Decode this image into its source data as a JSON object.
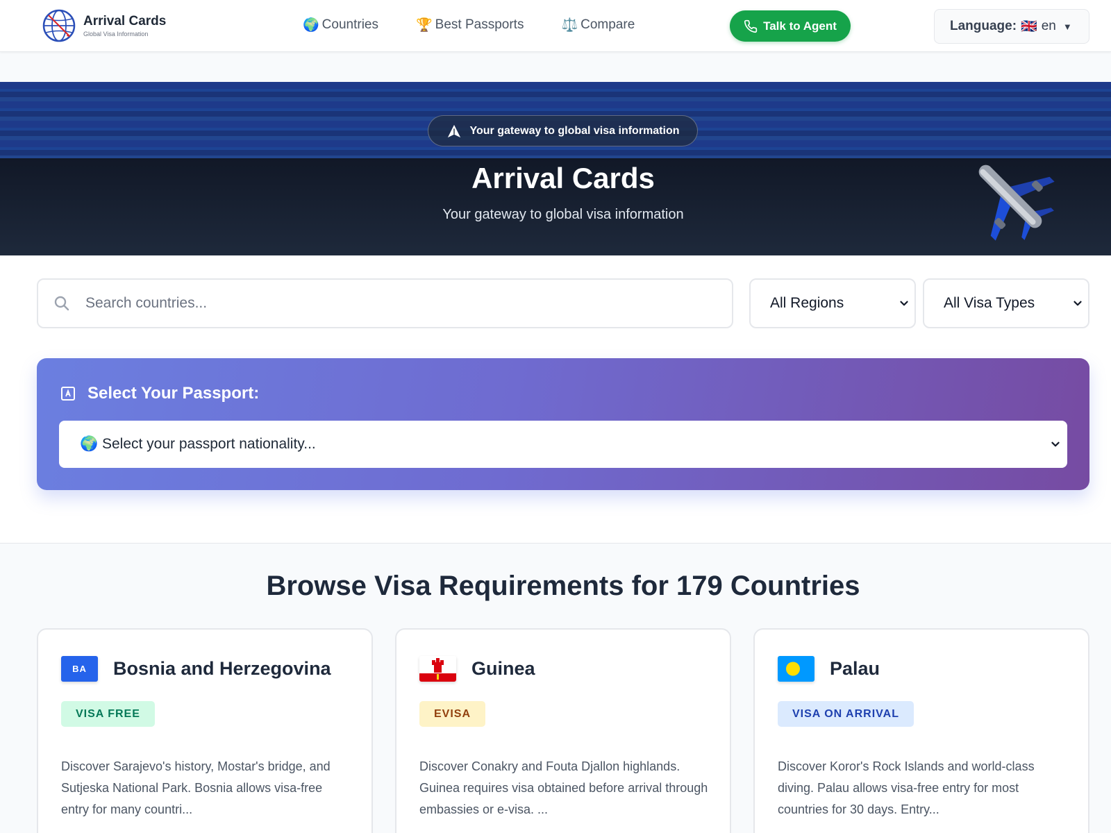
{
  "brand": {
    "title": "Arrival Cards",
    "subtitle": "Global Visa Information"
  },
  "nav": [
    {
      "icon": "🌍",
      "label": "Countries"
    },
    {
      "icon": "🏆",
      "label": "Best Passports"
    },
    {
      "icon": "⚖️",
      "label": "Compare"
    }
  ],
  "header": {
    "agent_button": "Talk to Agent",
    "language_label": "Language:",
    "language_flag": "🇬🇧",
    "language_code": "en",
    "language_caret": "▼"
  },
  "hero": {
    "badge": "Your gateway to global visa information",
    "title": "Arrival Cards",
    "subtitle": "Your gateway to global visa information",
    "plane_icon": "✈️"
  },
  "search": {
    "placeholder": "Search countries...",
    "region_value": "All Regions",
    "visa_value": "All Visa Types"
  },
  "passport": {
    "label": "Select Your Passport:",
    "select_value": "🌍 Select your passport nationality..."
  },
  "browse": {
    "title": "Browse Visa Requirements for 179 Countries"
  },
  "cards": [
    {
      "code": "BA",
      "name": "Bosnia and Herzegovina",
      "visa": "VISA FREE",
      "desc": "Discover Sarajevo's history, Mostar's bridge, and Sutjeska National Park. Bosnia allows visa-free entry for many countri..."
    },
    {
      "code": "",
      "name": "Guinea",
      "visa": "EVISA",
      "desc": "Discover Conakry and Fouta Djallon highlands. Guinea requires visa obtained before arrival through embassies or e-visa. ..."
    },
    {
      "code": "",
      "name": "Palau",
      "visa": "VISA ON ARRIVAL",
      "desc": "Discover Koror's Rock Islands and world-class diving. Palau allows visa-free entry for most countries for 30 days. Entry..."
    }
  ],
  "colors": {
    "agent_green": "#16a34a",
    "hero_dark": "#0f172a",
    "passport_gradient_start": "#6b7fe0",
    "passport_gradient_end": "#764ba2"
  }
}
